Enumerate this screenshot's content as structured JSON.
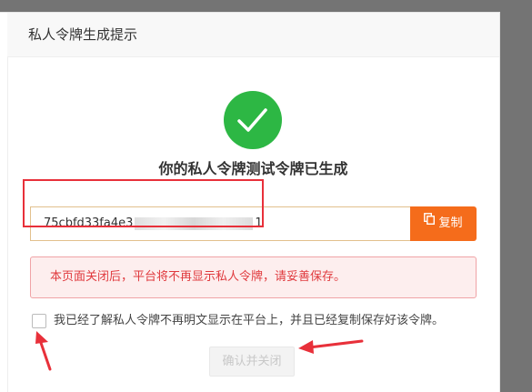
{
  "dialog": {
    "title": "私人令牌生成提示",
    "heading": "你的私人令牌测试令牌已生成",
    "token_visible_prefix": "75cbfd33fa4e3",
    "token_visible_suffix": "1",
    "copy_label": "复制",
    "warning": "本页面关闭后，平台将不再显示私人令牌，请妥善保存。",
    "confirm_text": "我已经了解私人令牌不再明文显示在平台上，并且已经复制保存好该令牌。",
    "close_label": "确认并关闭"
  },
  "colors": {
    "success": "#2db744",
    "accent": "#f56c1b",
    "danger": "#e03a3e",
    "annotation": "#e8303a"
  },
  "icons": {
    "success": "checkmark-icon",
    "copy": "copy-icon"
  }
}
